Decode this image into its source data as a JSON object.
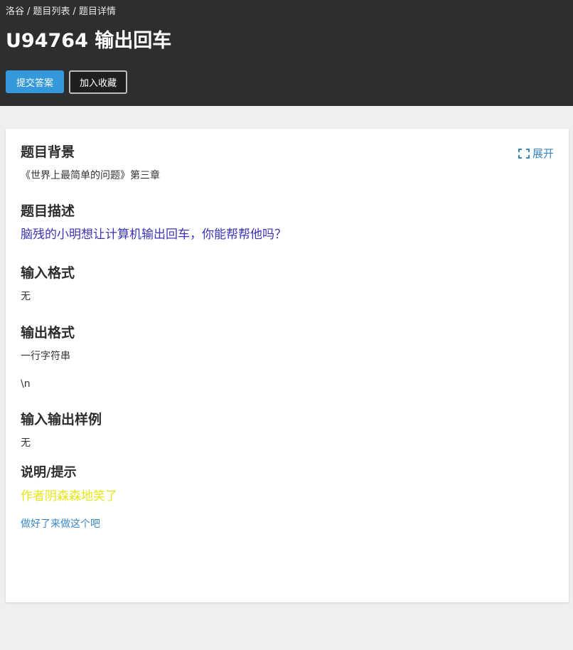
{
  "breadcrumb": {
    "items": [
      "洛谷",
      "题目列表",
      "题目详情"
    ],
    "separator": "/"
  },
  "problem": {
    "title": "U94764 输出回车"
  },
  "actions": {
    "submit_label": "提交答案",
    "favorite_label": "加入收藏"
  },
  "card": {
    "expand_label": "展开",
    "expand_icon": "expand-icon",
    "sections": {
      "background": {
        "title": "题目背景",
        "text": "《世界上最简单的问题》第三章"
      },
      "description": {
        "title": "题目描述",
        "text": "脑残的小明想让计算机输出回车，你能帮帮他吗？"
      },
      "input_format": {
        "title": "输入格式",
        "text": "无"
      },
      "output_format": {
        "title": "输出格式",
        "text": "一行字符串",
        "text2": "\\n"
      },
      "samples": {
        "title": "输入输出样例",
        "text": "无"
      },
      "hint": {
        "title": "说明/提示",
        "text": "作者阴森森地笑了",
        "link": "做好了来做这个吧"
      }
    }
  },
  "colors": {
    "header_bg": "#2d2e30",
    "primary": "#3498db",
    "link": "#3a87c5",
    "description": "#3b35b5",
    "hint": "#e6e61a",
    "page_bg": "#efefef"
  }
}
